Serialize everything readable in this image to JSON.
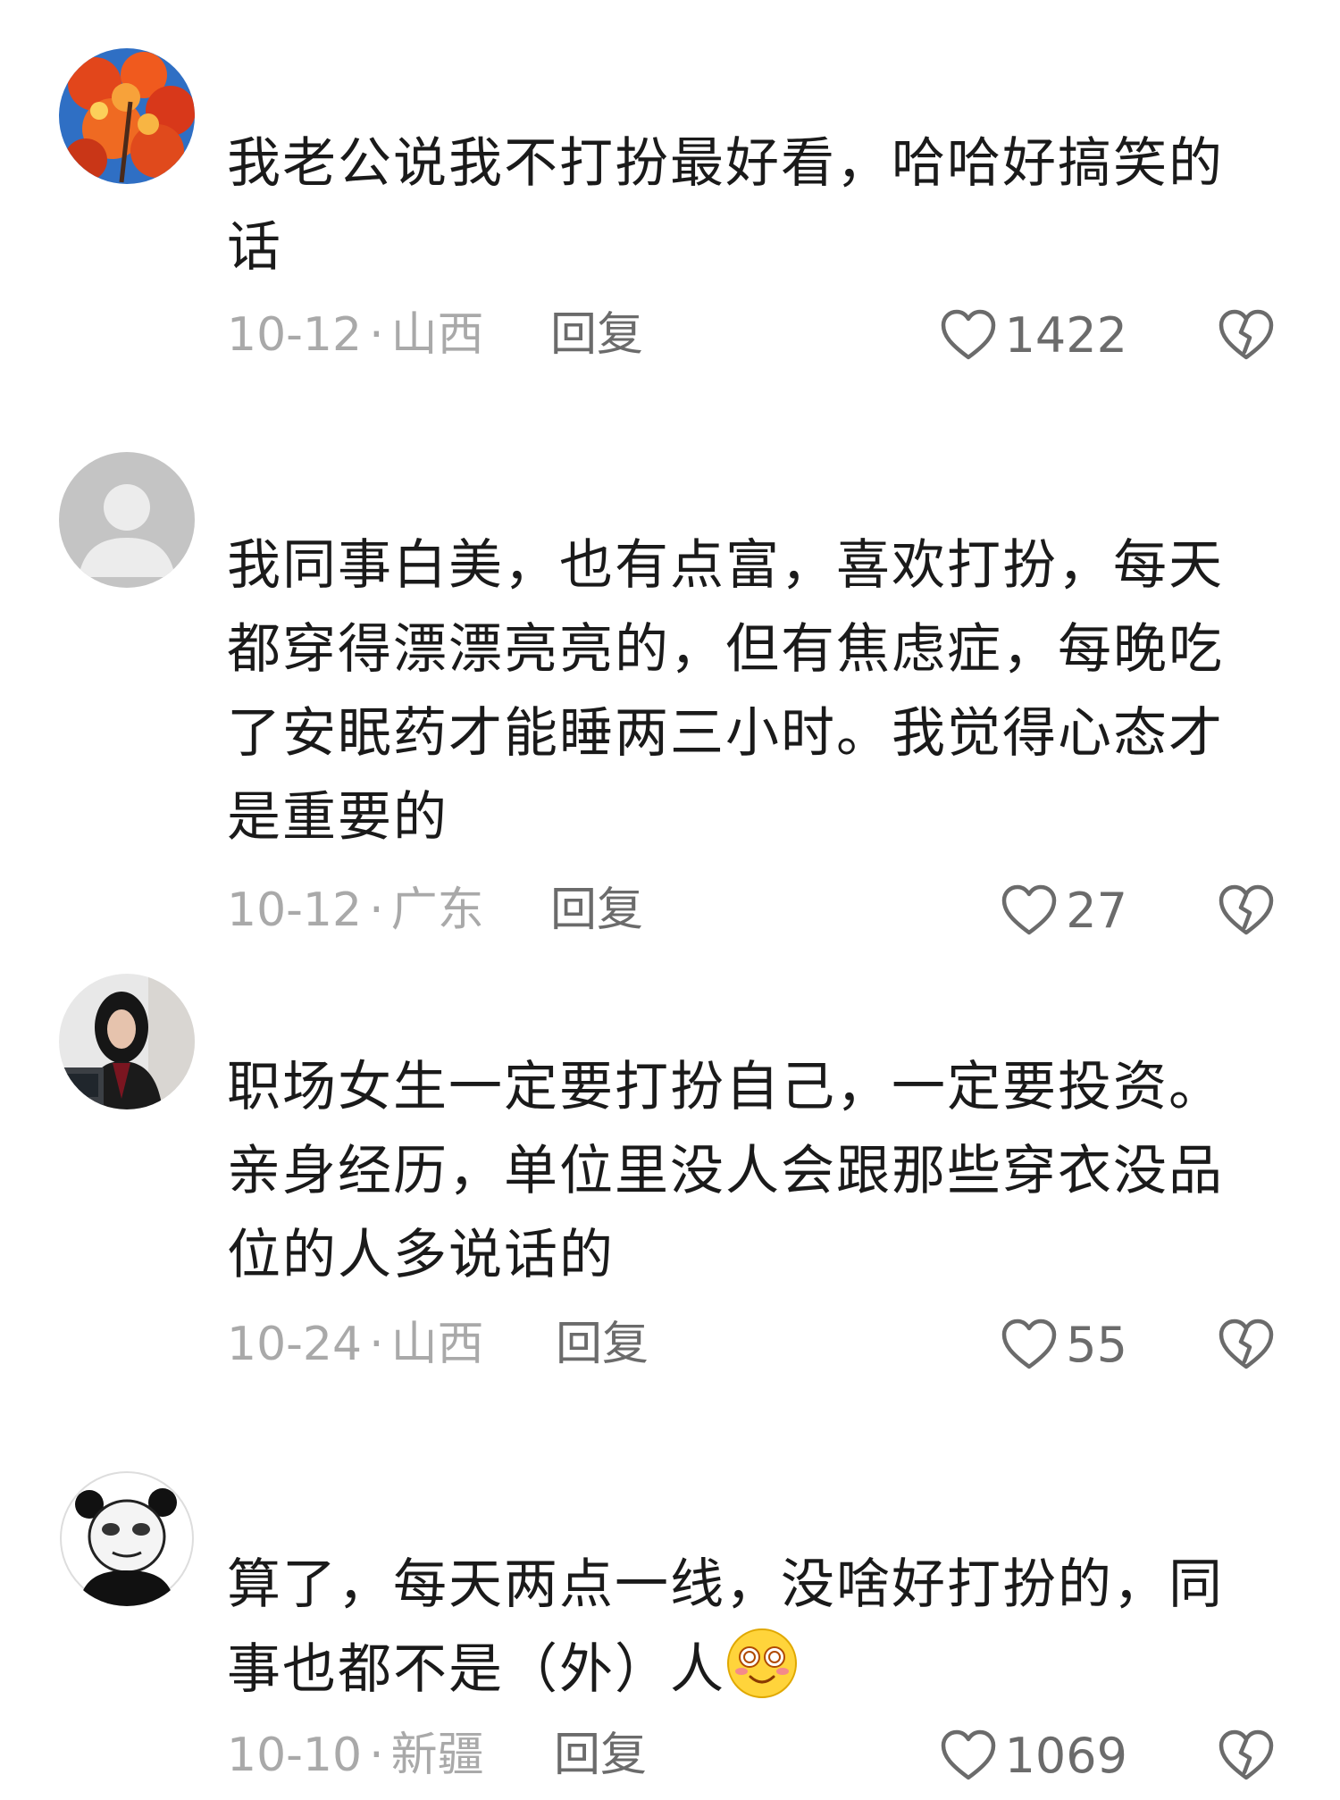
{
  "comments": [
    {
      "text": "我老公说我不打扮最好看，哈哈好搞笑的\n话",
      "date": "10-12",
      "location": "山西",
      "reply_label": "回复",
      "likes": "1422",
      "avatar_icon": "red-leaves-avatar"
    },
    {
      "text": "我同事白美，也有点富，喜欢打扮，每天\n都穿得漂漂亮亮的，但有焦虑症，每晚吃\n了安眠药才能睡两三小时。我觉得心态才\n是重要的",
      "date": "10-12",
      "location": "广东",
      "reply_label": "回复",
      "likes": "27",
      "avatar_icon": "default-user-avatar"
    },
    {
      "text": "职场女生一定要打扮自己，一定要投资。\n亲身经历，单位里没人会跟那些穿衣没品\n位的人多说话的",
      "date": "10-24",
      "location": "山西",
      "reply_label": "回复",
      "likes": "55",
      "avatar_icon": "woman-photo-avatar"
    },
    {
      "text_main": "算了，每天两点一线，没啥好打扮的，同\n事也都不是（外）人",
      "date": "10-10",
      "location": "新疆",
      "reply_label": "回复",
      "likes": "1069",
      "avatar_icon": "panda-meme-avatar",
      "emoji_icon": "dizzy-smile-emoji"
    }
  ],
  "separator": "·",
  "colors": {
    "text": "#1a1a1a",
    "meta": "#a9a9a9",
    "action": "#6b6b6b",
    "background": "#ffffff"
  }
}
